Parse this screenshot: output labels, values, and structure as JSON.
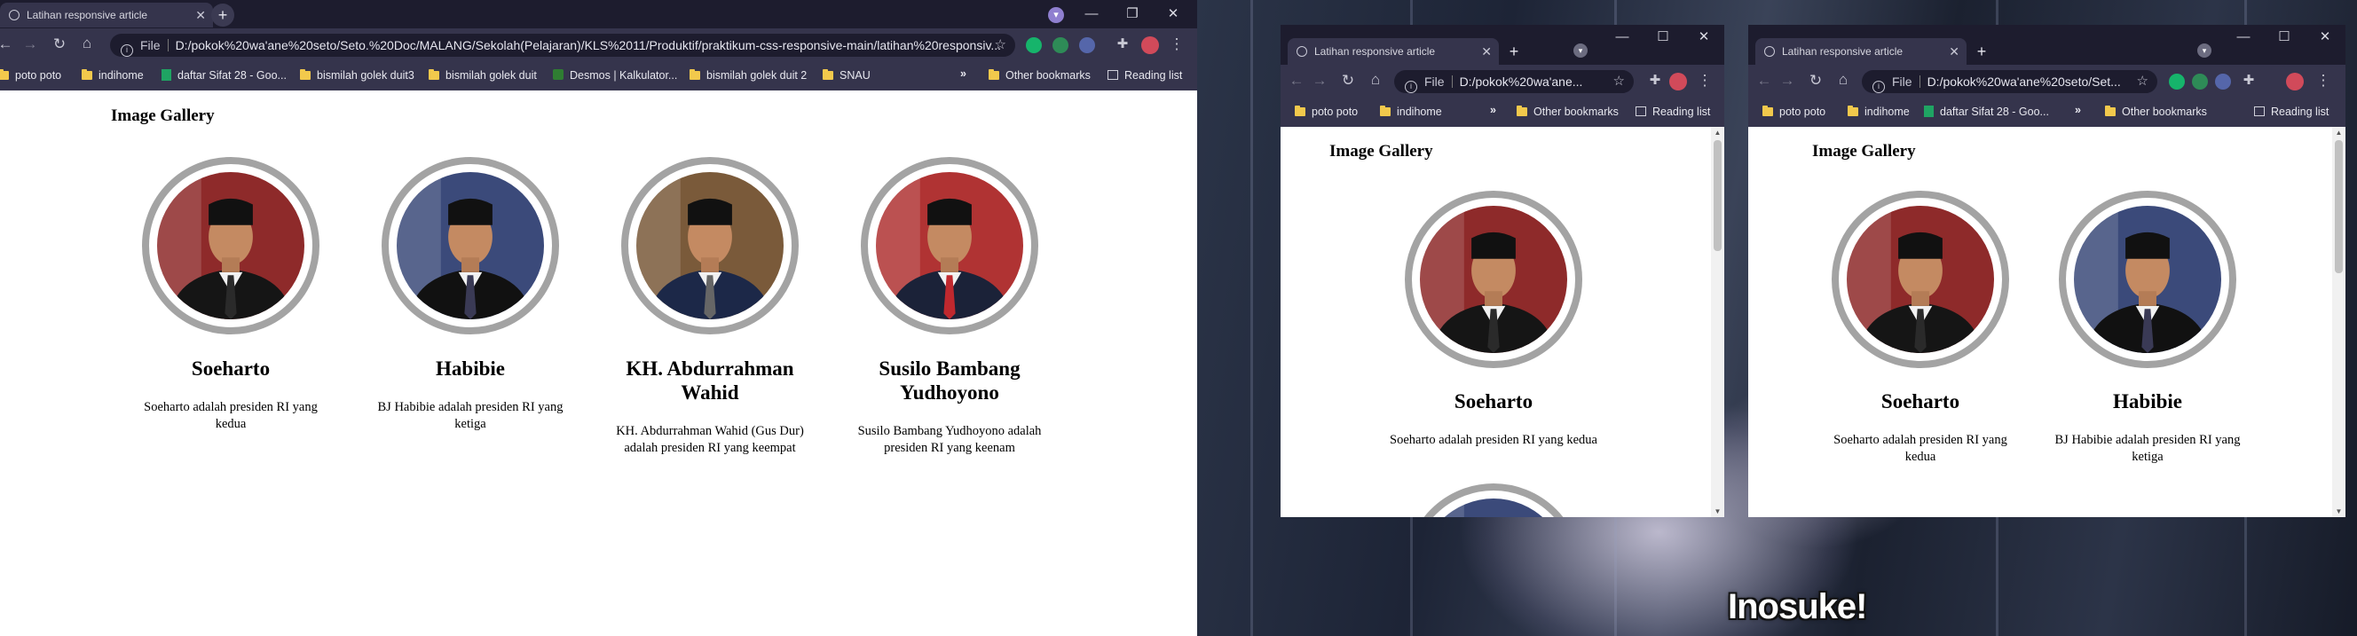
{
  "tab_title": "Latihan responsive article",
  "main_url": "D:/pokok%20wa'ane%20seto/Seto.%20Doc/MALANG/Sekolah(Pelajaran)/KLS%2011/Produktif/praktikum-css-responsive-main/latihan%20responsiv...",
  "small_url": "D:/pokok%20wa'ane...",
  "small_url_2": "D:/pokok%20wa'ane%20seto/Set...",
  "url_scheme": "File",
  "bookmarks": {
    "b1": "poto poto",
    "b2": "indihome",
    "b3": "daftar Sifat 28 - Goo...",
    "b4": "bismilah golek duit3",
    "b5": "bismilah golek duit",
    "b6": "Desmos | Kalkulator...",
    "b7": "bismilah golek duit 2",
    "b8": "SNAU",
    "other": "Other bookmarks",
    "reading": "Reading list",
    "more": "»"
  },
  "gallery": {
    "title": "Image Gallery",
    "people": [
      {
        "name": "Soeharto",
        "desc": "Soeharto adalah presiden RI yang kedua",
        "bg": "#8e2a2a",
        "suit": "#151515",
        "tie": "#2a2a2a"
      },
      {
        "name": "Habibie",
        "desc": "BJ Habibie adalah presiden RI yang ketiga",
        "bg": "#3b4a7a",
        "suit": "#111111",
        "tie": "#3a3a55"
      },
      {
        "name": "KH. Abdurrahman Wahid",
        "desc": "KH. Abdurrahman Wahid (Gus Dur) adalah presiden RI yang keempat",
        "bg": "#7a5a3a",
        "suit": "#1c2848",
        "tie": "#666666"
      },
      {
        "name": "Susilo Bambang Yudhoyono",
        "desc": "Susilo Bambang Yudhoyono adalah presiden RI yang keenam",
        "bg": "#b03333",
        "suit": "#1b2238",
        "tie": "#c0282e"
      }
    ]
  },
  "subtitle": "Inosuke!",
  "colors": {
    "chrome_dark": "#1d1c2e",
    "chrome": "#35344c",
    "ring": "#a3a3a3"
  }
}
